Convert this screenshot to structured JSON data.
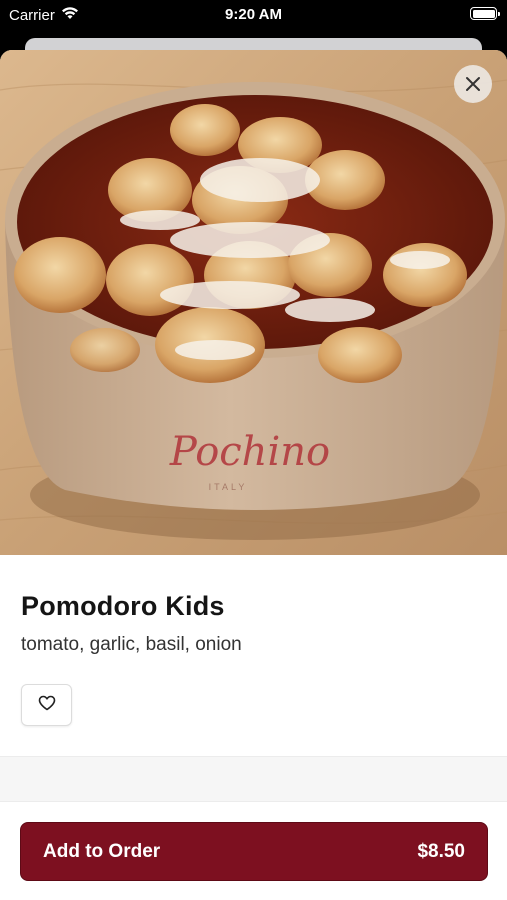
{
  "status_bar": {
    "carrier": "Carrier",
    "time": "9:20 AM"
  },
  "hero": {
    "image_label": "gnocchi bowl photo",
    "bowl_brand": "Pochino",
    "bowl_subtitle": "ITALY"
  },
  "item": {
    "title": "Pomodoro Kids",
    "description": "tomato, garlic, basil, onion"
  },
  "footer": {
    "add_label": "Add to Order",
    "price": "$8.50"
  },
  "colors": {
    "accent": "#7d1020"
  }
}
